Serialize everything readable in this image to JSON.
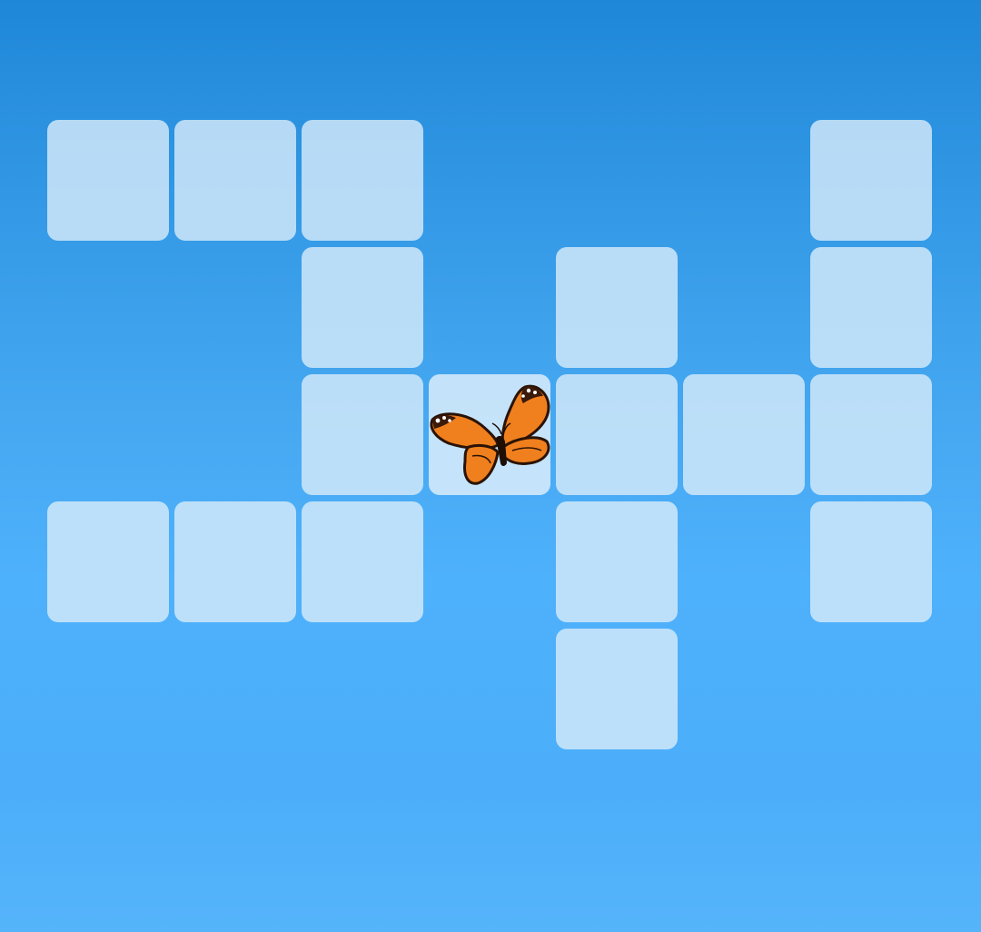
{
  "game": {
    "type": "tile-path-puzzle",
    "grid": {
      "columns": 7,
      "rows": 5
    },
    "player": {
      "icon": "butterfly-icon",
      "cell": {
        "col": 3,
        "row": 2
      },
      "colors": {
        "wing": "#f07f1e",
        "wing_edge": "#2a1306",
        "spots": "#ffffff"
      }
    },
    "tiles": [
      {
        "col": 0,
        "row": 0
      },
      {
        "col": 1,
        "row": 0
      },
      {
        "col": 2,
        "row": 0
      },
      {
        "col": 6,
        "row": 0
      },
      {
        "col": 2,
        "row": 1
      },
      {
        "col": 4,
        "row": 1
      },
      {
        "col": 6,
        "row": 1
      },
      {
        "col": 2,
        "row": 2
      },
      {
        "col": 3,
        "row": 2
      },
      {
        "col": 4,
        "row": 2
      },
      {
        "col": 5,
        "row": 2
      },
      {
        "col": 6,
        "row": 2
      },
      {
        "col": 0,
        "row": 3
      },
      {
        "col": 1,
        "row": 3
      },
      {
        "col": 2,
        "row": 3
      },
      {
        "col": 4,
        "row": 3
      },
      {
        "col": 6,
        "row": 3
      },
      {
        "col": 4,
        "row": 4
      }
    ],
    "colors": {
      "sky_top": "#1f87d8",
      "sky_bottom": "#55b4fa",
      "tile": "#daecfa"
    }
  }
}
